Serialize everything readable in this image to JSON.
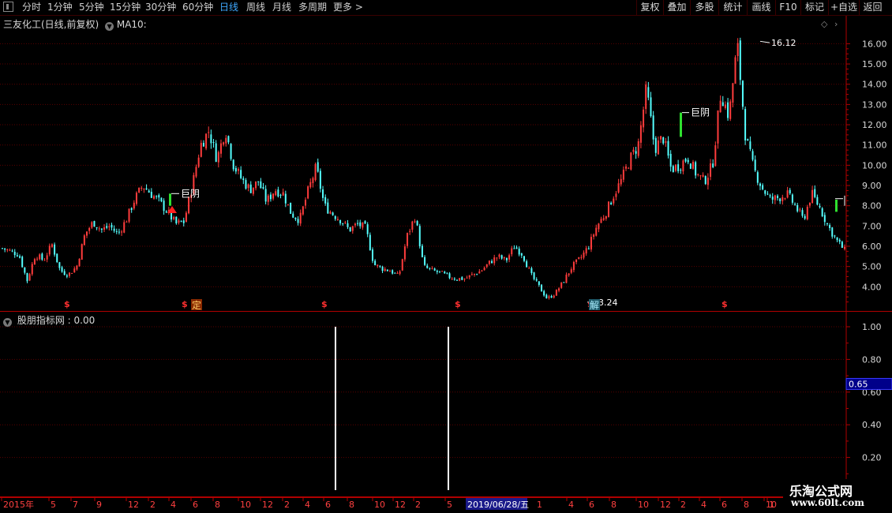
{
  "toolbar": {
    "periods": [
      "分时",
      "1分钟",
      "5分钟",
      "15分钟",
      "30分钟",
      "60分钟",
      "日线",
      "周线",
      "月线",
      "多周期",
      "更多"
    ],
    "active_period": "日线",
    "right_buttons": [
      "复权",
      "叠加",
      "多股",
      "统计",
      "画线",
      "F10",
      "标记",
      "+自选",
      "返回"
    ]
  },
  "price_panel": {
    "title": "三友化工(日线,前复权)",
    "indicator": "MA10:",
    "y_axis": [
      "16.00",
      "15.00",
      "14.00",
      "13.00",
      "12.00",
      "11.00",
      "10.00",
      "9.00",
      "8.00",
      "7.00",
      "6.00",
      "5.00",
      "4.00"
    ],
    "high_label": "16.12",
    "low_label": "3.24",
    "annotations": [
      "巨阴",
      "巨阴"
    ],
    "markers": [
      "$",
      "$",
      "$",
      "$",
      "$",
      "$"
    ],
    "tag_ding": "定",
    "tag_jie": "解"
  },
  "indicator_panel": {
    "title": "股朋指标网",
    "value": ": 0.00",
    "y_axis": [
      "1.00",
      "0.80",
      "0.60",
      "0.40",
      "0.20"
    ],
    "cursor_value": "0.65"
  },
  "time_axis": {
    "labels": [
      "2015年",
      "5",
      "7",
      "9",
      "12",
      "2",
      "4",
      "6",
      "8",
      "10",
      "12",
      "2",
      "4",
      "6",
      "8",
      "10",
      "12",
      "2",
      "5",
      "1",
      "4",
      "6",
      "8",
      "10",
      "12",
      "2",
      "4",
      "6",
      "8",
      "10",
      "1"
    ],
    "selected_date": "2019/06/28/五"
  },
  "watermark": {
    "title": "乐淘公式网",
    "url": "www.60lt.com"
  },
  "colors": {
    "up": "#ff3c3c",
    "down": "#54ffff",
    "grid": "#5a0000",
    "active": "#3fa9ff"
  },
  "chart_data": {
    "type": "candlestick",
    "ylim": [
      3.0,
      16.6
    ],
    "close_path_keypoints": [
      [
        0,
        5.9
      ],
      [
        2,
        5.6
      ],
      [
        3,
        4.3
      ],
      [
        4,
        5.6
      ],
      [
        5,
        5.3
      ],
      [
        6,
        6.1
      ],
      [
        7,
        4.8
      ],
      [
        8,
        4.6
      ],
      [
        9,
        5.0
      ],
      [
        10,
        6.6
      ],
      [
        11,
        7.2
      ],
      [
        12,
        6.8
      ],
      [
        13,
        7.0
      ],
      [
        14,
        6.6
      ],
      [
        15,
        7.3
      ],
      [
        16,
        8.3
      ],
      [
        17,
        9.0
      ],
      [
        18,
        8.6
      ],
      [
        19,
        8.2
      ],
      [
        20,
        7.7
      ],
      [
        21,
        7.1
      ],
      [
        22,
        7.2
      ],
      [
        23,
        9.0
      ],
      [
        24,
        11.0
      ],
      [
        25,
        11.7
      ],
      [
        26,
        10.3
      ],
      [
        27,
        11.8
      ],
      [
        28,
        10.0
      ],
      [
        29,
        9.3
      ],
      [
        30,
        8.8
      ],
      [
        31,
        9.2
      ],
      [
        32,
        8.2
      ],
      [
        33,
        8.8
      ],
      [
        34,
        8.6
      ],
      [
        35,
        7.6
      ],
      [
        36,
        7.3
      ],
      [
        37,
        8.7
      ],
      [
        38,
        9.9
      ],
      [
        39,
        8.0
      ],
      [
        40,
        7.6
      ],
      [
        41,
        7.3
      ],
      [
        42,
        6.8
      ],
      [
        43,
        7.1
      ],
      [
        44,
        6.9
      ],
      [
        45,
        5.1
      ],
      [
        46,
        4.9
      ],
      [
        47,
        4.8
      ],
      [
        48,
        4.5
      ],
      [
        49,
        6.5
      ],
      [
        50,
        7.5
      ],
      [
        51,
        5.0
      ],
      [
        52,
        4.8
      ],
      [
        53,
        4.7
      ],
      [
        54,
        4.5
      ],
      [
        55,
        4.4
      ],
      [
        56,
        4.4
      ],
      [
        57,
        4.6
      ],
      [
        58,
        4.8
      ],
      [
        59,
        5.2
      ],
      [
        60,
        5.5
      ],
      [
        61,
        5.3
      ],
      [
        62,
        6.0
      ],
      [
        63,
        5.6
      ],
      [
        64,
        4.6
      ],
      [
        65,
        4.0
      ],
      [
        66,
        3.4
      ],
      [
        67,
        3.7
      ],
      [
        68,
        4.3
      ],
      [
        69,
        5.0
      ],
      [
        70,
        5.4
      ],
      [
        71,
        6.0
      ],
      [
        72,
        7.0
      ],
      [
        73,
        7.6
      ],
      [
        74,
        8.5
      ],
      [
        75,
        9.3
      ],
      [
        76,
        10.3
      ],
      [
        77,
        11.0
      ],
      [
        78,
        13.8
      ],
      [
        79,
        10.8
      ],
      [
        80,
        11.4
      ],
      [
        81,
        9.8
      ],
      [
        82,
        10.0
      ],
      [
        83,
        10.4
      ],
      [
        84,
        9.6
      ],
      [
        85,
        9.2
      ],
      [
        86,
        10.0
      ],
      [
        87,
        13.6
      ],
      [
        88,
        12.4
      ],
      [
        89,
        16.0
      ],
      [
        90,
        11.4
      ],
      [
        91,
        9.8
      ],
      [
        92,
        8.9
      ],
      [
        93,
        8.3
      ],
      [
        94,
        8.4
      ],
      [
        95,
        8.6
      ],
      [
        96,
        8.0
      ],
      [
        97,
        7.3
      ],
      [
        98,
        8.6
      ],
      [
        99,
        7.9
      ],
      [
        100,
        7.0
      ],
      [
        101,
        6.3
      ],
      [
        102,
        5.8
      ]
    ],
    "indicator_spikes": [
      {
        "x_label": "2016 6",
        "value": 1.0
      },
      {
        "x_label": "2017 5",
        "value": 1.0
      }
    ]
  }
}
